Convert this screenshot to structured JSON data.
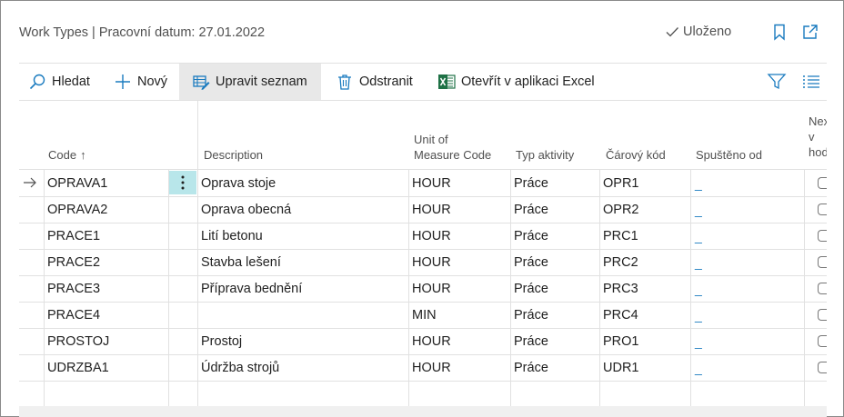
{
  "header": {
    "title": "Work Types | Pracovní datum: 27.01.2022",
    "saved_label": "Uloženo"
  },
  "actions": {
    "search": "Hledat",
    "new": "Nový",
    "edit_list": "Upravit seznam",
    "delete": "Odstranit",
    "open_excel": "Otevřít v aplikaci Excel"
  },
  "columns": {
    "code": "Code",
    "code_sort": "↑",
    "description": "Description",
    "uom_line1": "Unit of",
    "uom_line2": "Measure Code",
    "activity_type": "Typ aktivity",
    "barcode": "Čárový kód",
    "started_from": "Spuštěno od",
    "next_line1": "Nex",
    "next_line2": "v",
    "next_line3": "hod"
  },
  "rows": [
    {
      "code": "OPRAVA1",
      "description": "Oprava stoje",
      "uom": "HOUR",
      "activity": "Práce",
      "barcode": "OPR1",
      "started": "_"
    },
    {
      "code": "OPRAVA2",
      "description": "Oprava obecná",
      "uom": "HOUR",
      "activity": "Práce",
      "barcode": "OPR2",
      "started": "_"
    },
    {
      "code": "PRACE1",
      "description": "Lití betonu",
      "uom": "HOUR",
      "activity": "Práce",
      "barcode": "PRC1",
      "started": "_"
    },
    {
      "code": "PRACE2",
      "description": "Stavba lešení",
      "uom": "HOUR",
      "activity": "Práce",
      "barcode": "PRC2",
      "started": "_"
    },
    {
      "code": "PRACE3",
      "description": "Příprava bednění",
      "uom": "HOUR",
      "activity": "Práce",
      "barcode": "PRC3",
      "started": "_"
    },
    {
      "code": "PRACE4",
      "description": "",
      "uom": "MIN",
      "activity": "Práce",
      "barcode": "PRC4",
      "started": "_"
    },
    {
      "code": "PROSTOJ",
      "description": "Prostoj",
      "uom": "HOUR",
      "activity": "Práce",
      "barcode": "PRO1",
      "started": "_"
    },
    {
      "code": "UDRZBA1",
      "description": "Údržba strojů",
      "uom": "HOUR",
      "activity": "Práce",
      "barcode": "UDR1",
      "started": "_"
    }
  ],
  "icons": {
    "saved": "checkmark-icon",
    "bookmark": "bookmark-icon",
    "popout": "open-in-new-window-icon",
    "search": "search-icon",
    "new": "plus-icon",
    "edit_list": "edit-list-icon",
    "delete": "trash-icon",
    "excel": "excel-icon",
    "filter": "filter-icon",
    "list_view": "list-view-icon",
    "row_menu": "vertical-dots-icon",
    "current_row": "arrow-right-icon"
  },
  "colors": {
    "accent": "#1a7bbf",
    "selected_cell": "#b8e6ea",
    "excel_green": "#1e7145"
  }
}
